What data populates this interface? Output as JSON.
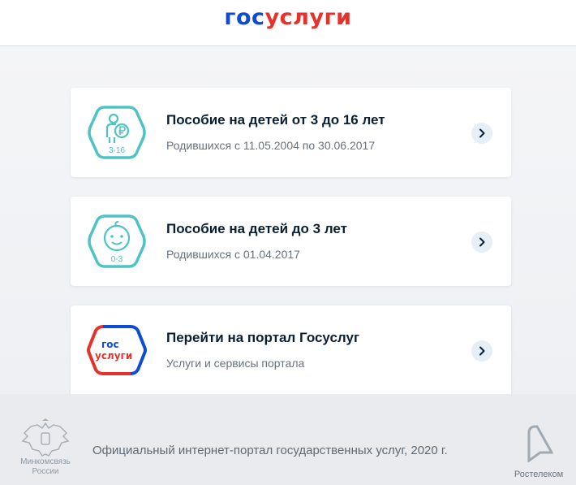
{
  "header": {
    "logo_part1": "гос",
    "logo_part2": "услуги"
  },
  "cards": [
    {
      "icon": "child-ruble-icon",
      "icon_label": "3-16",
      "title": "Пособие на детей от 3 до 16 лет",
      "subtitle": "Родившихся с 11.05.2004 по 30.06.2017"
    },
    {
      "icon": "baby-face-icon",
      "icon_label": "0-3",
      "title": "Пособие на детей до 3 лет",
      "subtitle": "Родившихся с 01.04.2017"
    },
    {
      "icon": "gosuslugi-logo-icon",
      "icon_label_1": "гос",
      "icon_label_2": "услуги",
      "title": "Перейти на портал Госуслуг",
      "subtitle": "Услуги и сервисы портала"
    }
  ],
  "footer": {
    "emblem_label": "Минкомсвязь России",
    "text": "Официальный интернет-портал государственных услуг, 2020 г.",
    "partner_label": "Ростелеком"
  },
  "colors": {
    "brand_blue": "#0d4cd3",
    "brand_red": "#e5322d",
    "accent_teal": "#4ec3c4",
    "arrow_bg": "#e6eef8"
  }
}
